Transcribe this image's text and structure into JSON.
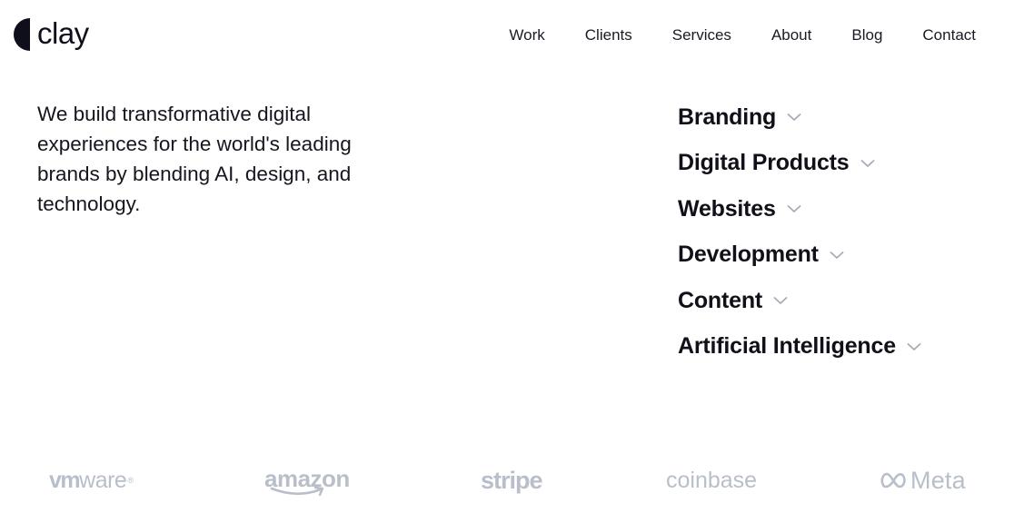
{
  "header": {
    "logo_text": "clay",
    "nav": [
      {
        "label": "Work"
      },
      {
        "label": "Clients"
      },
      {
        "label": "Services"
      },
      {
        "label": "About"
      },
      {
        "label": "Blog"
      },
      {
        "label": "Contact"
      }
    ]
  },
  "intro": {
    "text": "We build transformative digital experiences for the world's leading brands by blending AI, design, and technology."
  },
  "services": [
    {
      "label": "Branding",
      "icon": "chevron-down-icon"
    },
    {
      "label": "Digital Products",
      "icon": "chevron-down-icon"
    },
    {
      "label": "Websites",
      "icon": "chevron-down-icon"
    },
    {
      "label": "Development",
      "icon": "chevron-down-icon"
    },
    {
      "label": "Content",
      "icon": "chevron-down-icon"
    },
    {
      "label": "Artificial Intelligence",
      "icon": "chevron-down-icon"
    }
  ],
  "clients": {
    "vmware_vm": "vm",
    "vmware_ware": "ware",
    "vmware_reg": "®",
    "amazon": "amazon",
    "stripe": "stripe",
    "coinbase": "coinbase",
    "meta": "Meta"
  },
  "colors": {
    "text": "#11111b",
    "chevron": "#a8acb6",
    "client_logo": "#b9bfca",
    "background": "#ffffff"
  }
}
